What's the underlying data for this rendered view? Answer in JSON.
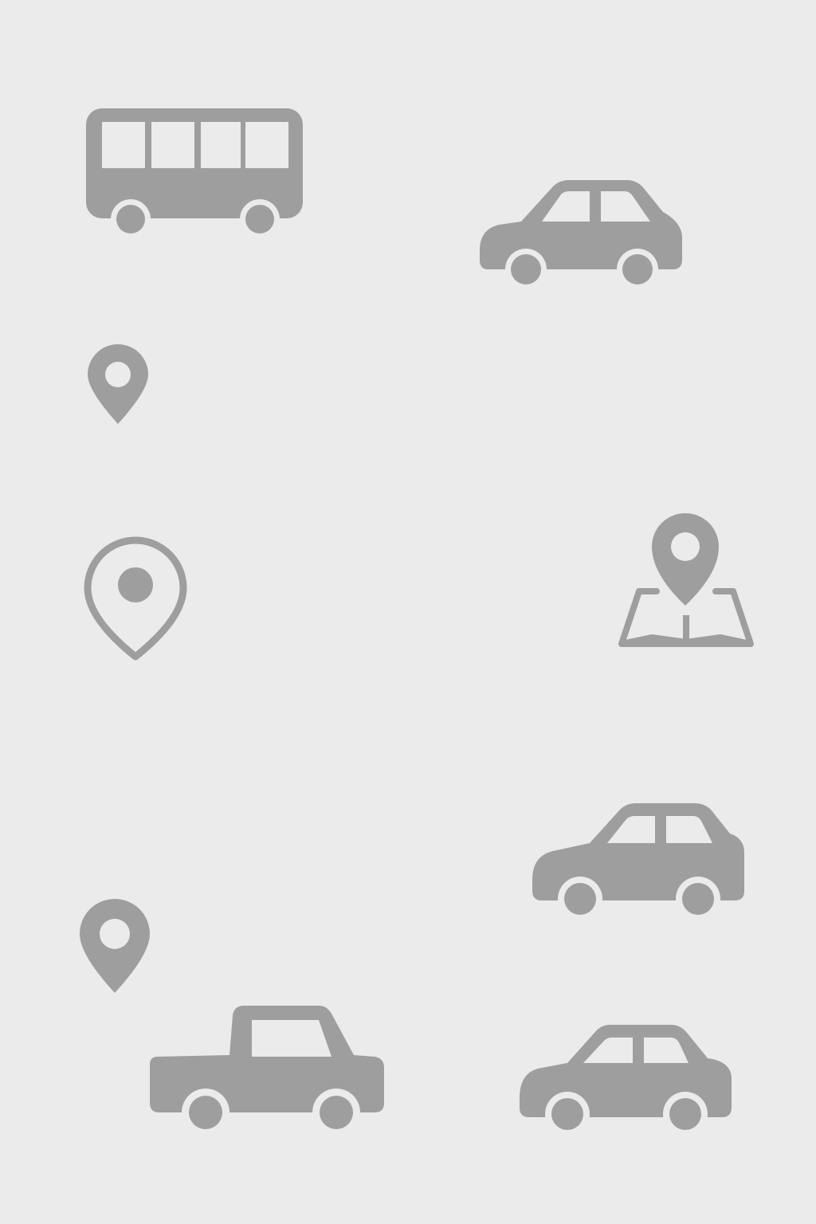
{
  "colors": {
    "background": "#ebebeb",
    "icon": "#9e9e9e"
  },
  "icons": [
    "bus-icon",
    "car-icon",
    "location-pin-icon",
    "location-pin-outline-icon",
    "map-pin-icon",
    "car-icon",
    "location-pin-icon",
    "pickup-truck-icon",
    "car-icon"
  ]
}
